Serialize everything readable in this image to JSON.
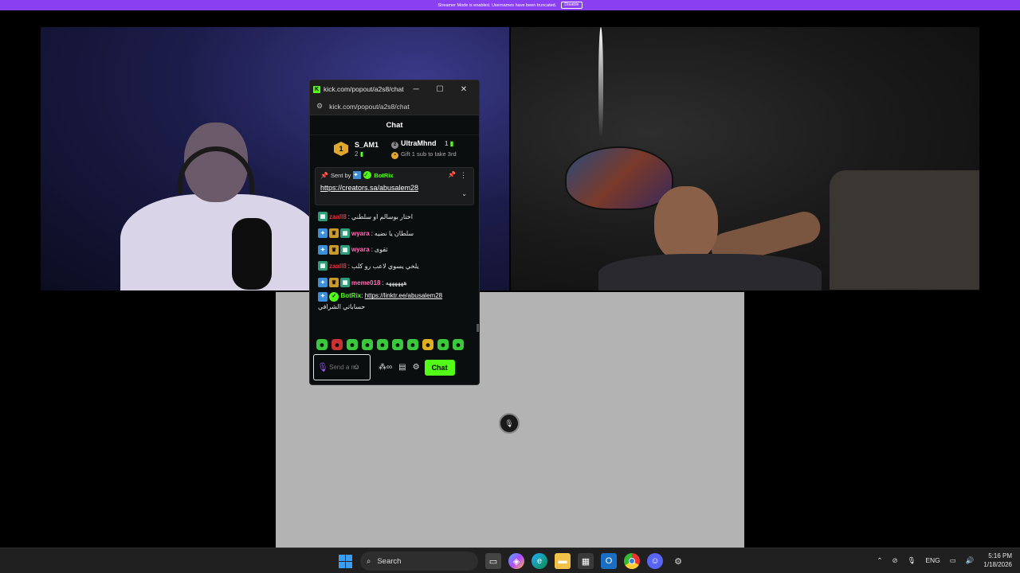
{
  "banner": {
    "text": "Streamer Mode is enabled. Usernames have been truncated.",
    "disable_label": "Disable"
  },
  "popout": {
    "title": "kick.com/popout/a2s8/chat...",
    "url": "kick.com/popout/a2s8/chat",
    "chat_title": "Chat",
    "leaderboard": {
      "first": {
        "rank": "1",
        "name": "S_AM1",
        "count": "2"
      },
      "second": {
        "name": "UltraMhnd",
        "count": "1",
        "gift_text": "Gift 1 sub to take 3rd"
      }
    },
    "pinned": {
      "sent_by": "Sent by",
      "author": "BotRix",
      "link": "https://creators.sa/abusalem28"
    },
    "messages": [
      {
        "user": "zaall8",
        "text": "اختار بوسالم او سلطني"
      },
      {
        "user": "wyara",
        "text": "سلطان يا نضيه"
      },
      {
        "user": "wyara",
        "text": "ثقوى"
      },
      {
        "user": "zaall8",
        "text": "يلخي يسوي لاعب رو كلب"
      },
      {
        "user": "meme018",
        "text": "ههههههه"
      },
      {
        "user": "BotRix",
        "link": "https://linktr.ee/abusalem28",
        "text": "حساباتي الشرافي"
      }
    ],
    "input_placeholder": "Send a message",
    "chat_button": "Chat"
  },
  "taskbar": {
    "search_label": "Search",
    "language": "ENG",
    "time": "5:16 PM",
    "date": "1/18/2026"
  },
  "colors": {
    "kick_green": "#53fc18",
    "banner_purple": "#8a3ff0",
    "username_red": "#e0323c"
  },
  "icons": [
    "windows-start-icon",
    "search-icon",
    "task-view-icon",
    "copilot-icon",
    "edge-icon",
    "file-explorer-icon",
    "store-icon",
    "outlook-icon",
    "chrome-icon",
    "discord-icon",
    "settings-icon"
  ]
}
